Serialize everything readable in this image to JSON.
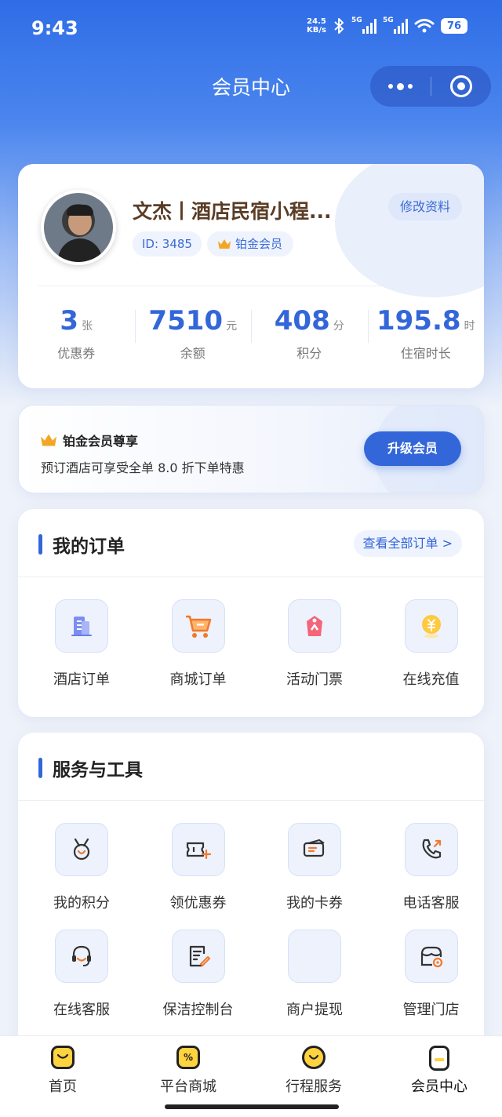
{
  "status_bar": {
    "time": "9:43",
    "net_speed_value": "24.5",
    "net_speed_unit": "KB/s",
    "signal_1_tag": "5G",
    "signal_2_tag": "5G",
    "battery": "76"
  },
  "nav": {
    "title": "会员中心"
  },
  "profile": {
    "name": "文杰丨酒店民宿小程...",
    "edit_label": "修改资料",
    "id_text": "ID: 3485",
    "tier": "铂金会员",
    "stats": [
      {
        "value": "3",
        "unit": "张",
        "label": "优惠券"
      },
      {
        "value": "7510",
        "unit": "元",
        "label": "余额"
      },
      {
        "value": "408",
        "unit": "分",
        "label": "积分"
      },
      {
        "value": "195.8",
        "unit": "时",
        "label": "住宿时长"
      }
    ]
  },
  "vip": {
    "title": "铂金会员尊享",
    "description": "预订酒店可享受全单 8.0 折下单特惠",
    "upgrade_label": "升级会员"
  },
  "orders": {
    "title": "我的订单",
    "view_all": "查看全部订单 >",
    "items": [
      {
        "label": "酒店订单",
        "icon": "hotel-building-icon"
      },
      {
        "label": "商城订单",
        "icon": "shopping-cart-icon"
      },
      {
        "label": "活动门票",
        "icon": "ticket-tag-icon"
      },
      {
        "label": "在线充值",
        "icon": "yuan-coin-icon"
      }
    ]
  },
  "tools": {
    "title": "服务与工具",
    "items": [
      {
        "label": "我的积分",
        "icon": "medal-icon"
      },
      {
        "label": "领优惠券",
        "icon": "coupon-add-icon"
      },
      {
        "label": "我的卡券",
        "icon": "card-voucher-icon"
      },
      {
        "label": "电话客服",
        "icon": "phone-icon"
      },
      {
        "label": "在线客服",
        "icon": "headset-icon"
      },
      {
        "label": "保洁控制台",
        "icon": "document-edit-icon"
      },
      {
        "label": "商户提现",
        "icon": ""
      },
      {
        "label": "管理门店",
        "icon": "store-settings-icon"
      }
    ]
  },
  "tabbar": {
    "items": [
      {
        "label": "首页",
        "icon": "home-icon"
      },
      {
        "label": "平台商城",
        "icon": "percent-shop-icon"
      },
      {
        "label": "行程服务",
        "icon": "trip-service-icon"
      },
      {
        "label": "会员中心",
        "icon": "member-icon"
      }
    ],
    "active_index": 3
  },
  "colors": {
    "primary": "#3366d9",
    "header_gradient_top": "#2f6de6",
    "crown": "#f3a626",
    "tab_icon_fill": "#ffd23f"
  }
}
